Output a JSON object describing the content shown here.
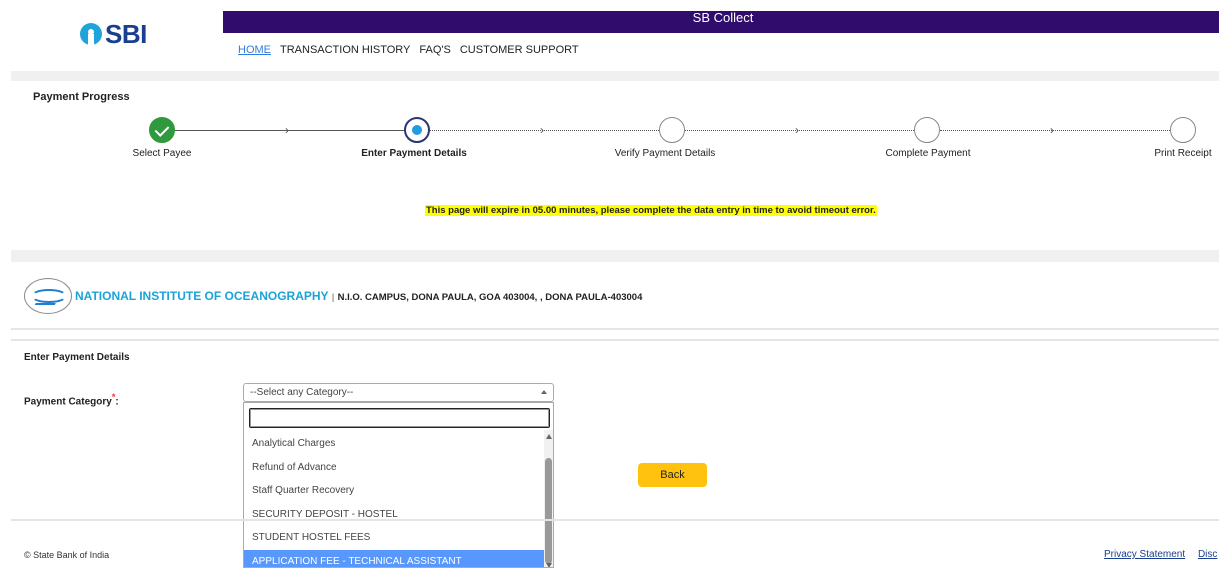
{
  "header": {
    "logo_text": "SBI",
    "bar_title": "SB Collect",
    "nav": [
      "HOME",
      "TRANSACTION HISTORY",
      "FAQ'S",
      "CUSTOMER SUPPORT"
    ]
  },
  "progress": {
    "title": "Payment Progress",
    "steps": [
      "Select Payee",
      "Enter Payment Details",
      "Verify Payment Details",
      "Complete Payment",
      "Print Receipt"
    ],
    "expiry_notice": "This page will expire in 05.00 minutes, please complete the data entry in time to avoid timeout error."
  },
  "institute": {
    "name": "NATIONAL INSTITUTE OF OCEANOGRAPHY",
    "separator": "|",
    "address": "N.I.O. CAMPUS, DONA PAULA, GOA 403004, , DONA PAULA-403004"
  },
  "form": {
    "title": "Enter Payment Details",
    "category_label": "Payment Category",
    "required_mark": "*",
    "colon": ":",
    "select_value": "--Select any Category--",
    "options": [
      "Analytical Charges",
      "Refund of Advance",
      "Staff Quarter Recovery",
      "SECURITY DEPOSIT - HOSTEL",
      "STUDENT HOSTEL FEES",
      "APPLICATION FEE - TECHNICAL ASSISTANT"
    ],
    "back_label": "Back"
  },
  "footer": {
    "copyright": "© State Bank of India",
    "links": [
      "Privacy Statement",
      "Disc"
    ]
  },
  "colors": {
    "brand_purple": "#300d6d",
    "accent_yellow": "#ffc20e",
    "selected_option": "#5897fb"
  }
}
